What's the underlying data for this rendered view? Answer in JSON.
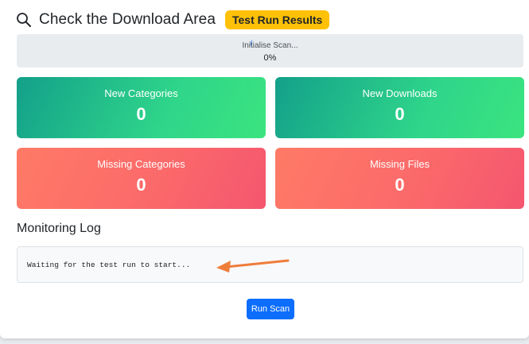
{
  "header": {
    "title": "Check the Download Area",
    "badge": "Test Run Results",
    "icon": "search-icon"
  },
  "progress": {
    "status": "Initialise Scan...",
    "percent_label": "0%",
    "percent": 0
  },
  "stats": [
    {
      "label": "New Categories",
      "value": "0"
    },
    {
      "label": "New Downloads",
      "value": "0"
    },
    {
      "label": "Missing Categories",
      "value": "0"
    },
    {
      "label": "Missing Files",
      "value": "0"
    }
  ],
  "log": {
    "title": "Monitoring Log",
    "message": "Waiting for the test run to start..."
  },
  "actions": {
    "run_label": "Run Scan"
  },
  "colors": {
    "badge": "#ffc107",
    "button": "#0d6efd",
    "success_start": "#13a08a",
    "success_end": "#3be47f",
    "danger_start": "#ff7a66",
    "danger_end": "#f4566f",
    "annotation_arrow": "#ee7d3b"
  }
}
